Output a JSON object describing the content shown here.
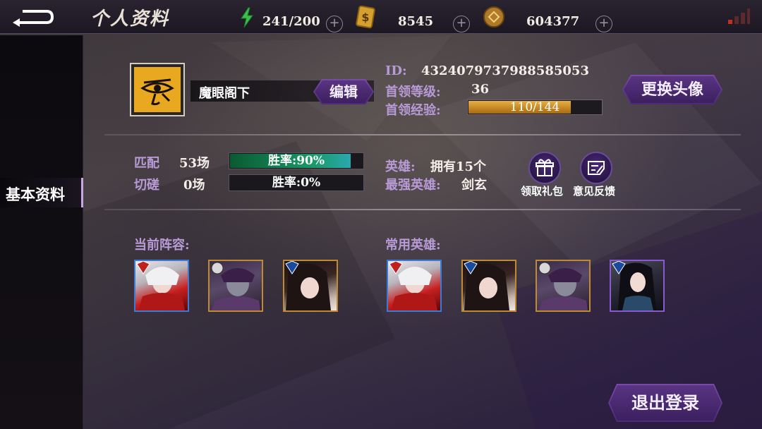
{
  "header": {
    "title": "个人资料",
    "energy": "241/200",
    "tickets": "8545",
    "coins": "604377"
  },
  "sidebar": {
    "tabs": [
      {
        "label": "基本资料",
        "active": true
      }
    ]
  },
  "profile": {
    "name": "魔眼阁下",
    "edit_label": "编辑",
    "change_avatar_label": "更换头像",
    "id_label": "ID:",
    "id_value": "4324079737988585053",
    "level_label": "首领等级:",
    "level_value": "36",
    "exp_label": "首领经验:",
    "exp_text": "110/144",
    "exp_fraction": 0.764
  },
  "stats": {
    "match_label": "匹配",
    "match_count": "53场",
    "match_rate_text": "胜率:90%",
    "match_rate": 0.9,
    "spar_label": "切磋",
    "spar_count": "0场",
    "spar_rate_text": "胜率:0%",
    "spar_rate": 0.0,
    "hero_label": "英雄:",
    "hero_value": "拥有15个",
    "strongest_label": "最强英雄:",
    "strongest_value": "剑玄",
    "gift_label": "领取礼包",
    "feedback_label": "意见反馈"
  },
  "lineup": {
    "current_title": "当前阵容:",
    "common_title": "常用英雄:"
  },
  "footer": {
    "logout_label": "退出登录"
  },
  "colors": {
    "accent_purple": "#b89ad6",
    "button_purple": "#5a3482",
    "gold": "#e8a820"
  }
}
